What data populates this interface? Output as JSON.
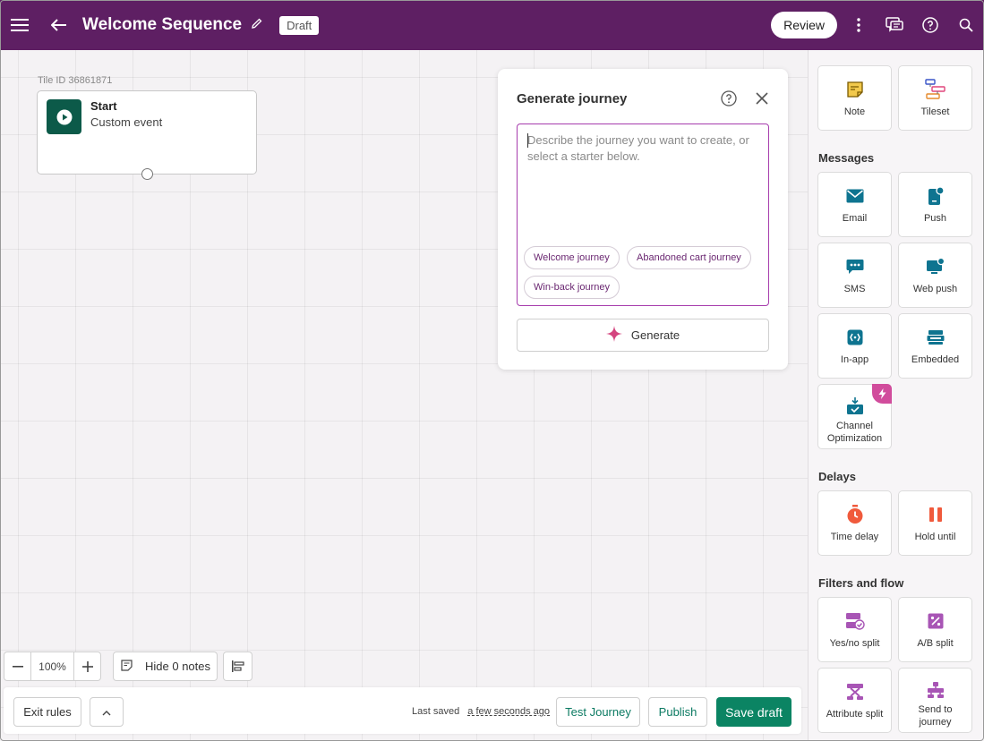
{
  "header": {
    "title": "Welcome Sequence",
    "status_badge": "Draft",
    "review_label": "Review"
  },
  "canvas": {
    "tile_id": "Tile ID 36861871",
    "start_tile": {
      "title": "Start",
      "subtitle": "Custom event"
    }
  },
  "generate_panel": {
    "title": "Generate journey",
    "placeholder": "Describe the journey you want to create, or select a starter below.",
    "starters": [
      "Welcome journey",
      "Abandoned cart journey",
      "Win-back journey"
    ],
    "generate_label": "Generate"
  },
  "zoom": {
    "level": "100%"
  },
  "notes": {
    "label": "Hide 0 notes"
  },
  "footer": {
    "exit_rules": "Exit rules",
    "last_saved_prefix": "Last saved",
    "last_saved_time": "a few seconds ago",
    "test_journey": "Test Journey",
    "publish": "Publish",
    "save_draft": "Save draft"
  },
  "sidebar": {
    "top_items": [
      {
        "label": "Note",
        "icon": "note-icon"
      },
      {
        "label": "Tileset",
        "icon": "tileset-icon"
      }
    ],
    "sections": {
      "messages": {
        "title": "Messages",
        "items": [
          {
            "label": "Email",
            "icon": "email-icon"
          },
          {
            "label": "Push",
            "icon": "push-icon"
          },
          {
            "label": "SMS",
            "icon": "sms-icon"
          },
          {
            "label": "Web push",
            "icon": "web-push-icon"
          },
          {
            "label": "In-app",
            "icon": "in-app-icon"
          },
          {
            "label": "Embedded",
            "icon": "embedded-icon"
          },
          {
            "label": "Channel Optimization",
            "icon": "channel-optimization-icon"
          }
        ]
      },
      "delays": {
        "title": "Delays",
        "items": [
          {
            "label": "Time delay",
            "icon": "timer-icon"
          },
          {
            "label": "Hold until",
            "icon": "pause-icon"
          }
        ]
      },
      "filters": {
        "title": "Filters and flow",
        "items": [
          {
            "label": "Yes/no split",
            "icon": "yes-no-split-icon"
          },
          {
            "label": "A/B split",
            "icon": "ab-split-icon"
          },
          {
            "label": "Attribute split",
            "icon": "attribute-split-icon"
          },
          {
            "label": "Send to journey",
            "icon": "send-to-journey-icon"
          }
        ]
      }
    }
  },
  "colors": {
    "header_bg": "#5e1f63",
    "primary_green": "#0b8463",
    "accent_purple": "#a63cad",
    "message_teal": "#0e7490",
    "delay_orange": "#f05a3c",
    "flow_purple": "#a855b5"
  }
}
